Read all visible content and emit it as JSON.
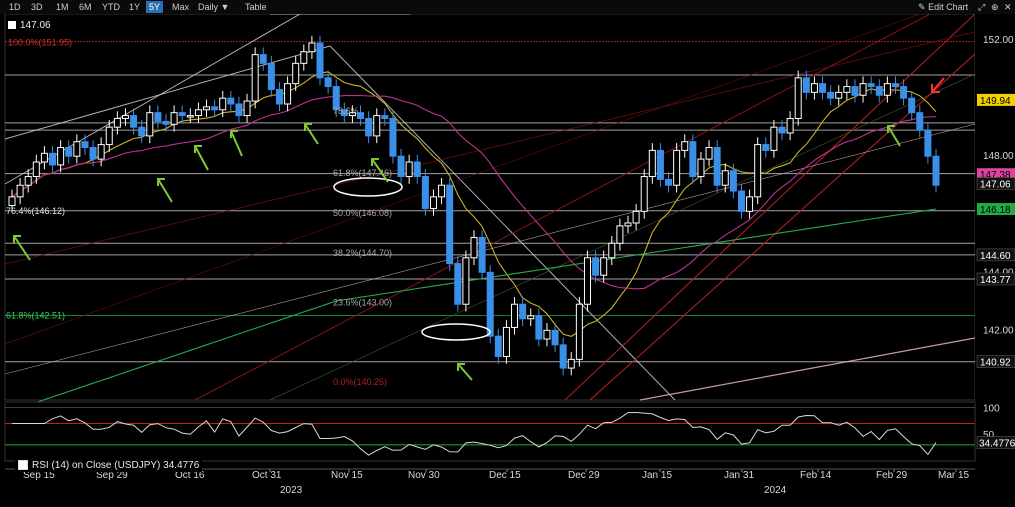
{
  "toolbar": {
    "ranges": [
      "1D",
      "3D",
      "1M",
      "6M",
      "YTD",
      "1Y",
      "5Y",
      "Max"
    ],
    "active_range": "5Y",
    "interval": "Daily ▼",
    "table": "Table",
    "edit_chart": "Edit Chart",
    "icons": [
      "expand-icon",
      "zoom-icon",
      "close-icon"
    ]
  },
  "price_label": "147.06",
  "rsi_legend": "RSI (14)  on Close (USDJPY) 34.4776",
  "colors": {
    "up": "#ffffff",
    "down": "#3a8fe8",
    "ma20": "#c9b22a",
    "ma50": "#c0308f",
    "ma200": "#2aa84a",
    "fib": "#b12020"
  },
  "chart_data": [
    {
      "type": "candlestick",
      "title": "USDJPY",
      "x_labels": [
        "Sep 15",
        "Sep 29",
        "Oct 16",
        "Oct 31",
        "Nov 15",
        "Nov 30",
        "Dec 15",
        "Dec 29",
        "Jan 15",
        "Jan 31",
        "Feb 14",
        "Feb 29",
        "Mar 15"
      ],
      "year_labels": [
        "2023",
        "2024"
      ],
      "y_ticks": [
        152.0,
        148.0,
        144.0,
        142.0
      ],
      "ylim": [
        139.6,
        152.9
      ],
      "price_axis_tags": [
        {
          "value": 149.94,
          "color": "#f0d000"
        },
        {
          "value": 147.38,
          "color": "#e040a0"
        },
        {
          "value": 147.06,
          "color": "#ffffff"
        },
        {
          "value": 146.18,
          "color": "#22aa44"
        },
        {
          "value": 144.6,
          "color": "#ffffff"
        },
        {
          "value": 143.77,
          "color": "#ffffff"
        },
        {
          "value": 140.92,
          "color": "#ffffff"
        }
      ],
      "fib_labels": [
        {
          "text": "100.0%(151.95)",
          "value": 151.95
        },
        {
          "text": "78.6%",
          "value": 149.6
        },
        {
          "text": "61.8%(147.46)",
          "value": 147.46
        },
        {
          "text": "50.0%(146.08)",
          "value": 146.08
        },
        {
          "text": "38.2%(144.70)",
          "value": 144.7
        },
        {
          "text": "23.6%(143.00)",
          "value": 143.0
        },
        {
          "text": "0.0%(140.25)",
          "value": 140.25
        }
      ],
      "left_labels": [
        {
          "text": "76.4%(146.12)",
          "value": 146.12
        },
        {
          "text": "61.8%(142.51)",
          "value": 142.51
        }
      ],
      "horizontal_levels": [
        151.95,
        150.8,
        149.15,
        148.9,
        147.4,
        146.12,
        145.0,
        144.6,
        143.77,
        142.51,
        140.92
      ],
      "closes": [
        146.6,
        147.0,
        147.3,
        147.8,
        148.1,
        147.7,
        148.3,
        148.0,
        148.5,
        148.3,
        147.9,
        148.4,
        149.0,
        149.3,
        149.4,
        149.0,
        148.7,
        149.5,
        149.2,
        149.1,
        149.5,
        149.4,
        149.4,
        149.6,
        149.7,
        149.6,
        150.0,
        149.8,
        149.4,
        149.9,
        151.5,
        151.2,
        150.3,
        149.8,
        150.5,
        151.2,
        151.6,
        151.9,
        150.7,
        150.4,
        149.6,
        149.4,
        149.5,
        149.3,
        148.7,
        149.4,
        149.3,
        148.0,
        147.3,
        147.8,
        147.3,
        146.2,
        146.6,
        147.0,
        144.3,
        142.9,
        144.5,
        145.2,
        144.0,
        141.8,
        141.1,
        142.1,
        142.9,
        142.4,
        142.5,
        141.7,
        142.0,
        141.5,
        140.7,
        141.0,
        142.9,
        144.5,
        143.9,
        144.5,
        145.0,
        145.6,
        145.7,
        146.1,
        147.3,
        148.2,
        147.2,
        147.0,
        148.2,
        148.5,
        147.3,
        147.9,
        148.3,
        147.0,
        147.5,
        146.8,
        146.1,
        146.6,
        148.4,
        148.2,
        149.0,
        148.8,
        149.3,
        150.7,
        150.2,
        150.5,
        150.2,
        150.0,
        150.2,
        150.4,
        150.1,
        150.5,
        150.4,
        150.1,
        150.5,
        150.4,
        150.0,
        149.5,
        148.9,
        148.0,
        147.0
      ],
      "rsi": {
        "ylim": [
          0,
          110
        ],
        "y_ticks": [
          100,
          50
        ],
        "levels": [
          70,
          30
        ],
        "last": 34.4776
      }
    }
  ]
}
